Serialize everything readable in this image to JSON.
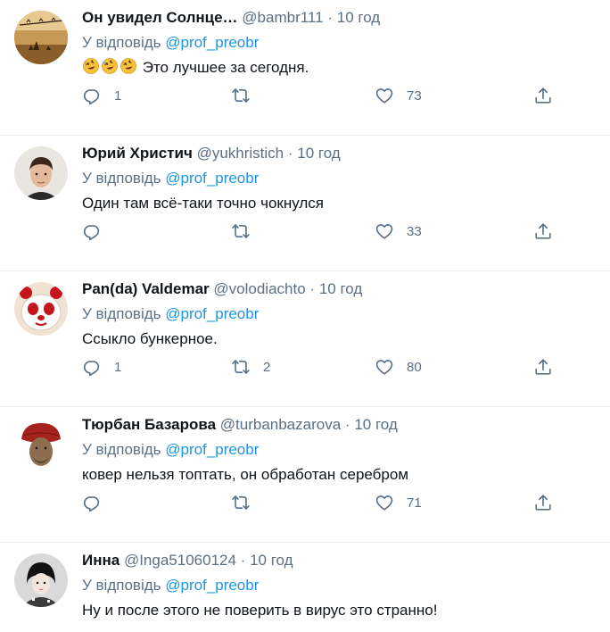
{
  "reply_prefix": "У відповідь",
  "tweets": [
    {
      "name": "Он увидел Солнце…",
      "handle": "@bambr111",
      "time": "10 год",
      "reply_to": "@prof_preobr",
      "text": "Это лучшее за сегодня.",
      "emoji": [
        "rolling-on-floor-laughing",
        "rolling-on-floor-laughing",
        "rolling-on-floor-laughing"
      ],
      "replies": "1",
      "retweets": "",
      "likes": "73"
    },
    {
      "name": "Юрий Христич",
      "handle": "@yukhristich",
      "time": "10 год",
      "reply_to": "@prof_preobr",
      "text": "Один там всё-таки точно чокнулся",
      "replies": "",
      "retweets": "",
      "likes": "33"
    },
    {
      "name": "Pan(da) Valdemar",
      "handle": "@volodiachto",
      "time": "10 год",
      "reply_to": "@prof_preobr",
      "text": "Ссыкло бункерное.",
      "replies": "1",
      "retweets": "2",
      "likes": "80"
    },
    {
      "name": "Тюрбан Базарова",
      "handle": "@turbanbazarova",
      "time": "10 год",
      "reply_to": "@prof_preobr",
      "text": "ковер нельзя топтать, он обработан серебром",
      "replies": "",
      "retweets": "",
      "likes": "71"
    },
    {
      "name": "Инна",
      "handle": "@Inga51060124",
      "time": "10 год",
      "reply_to": "@prof_preobr",
      "text": "Ну и после этого не поверить в вирус это странно!"
    }
  ],
  "icons": {
    "reply": "reply-icon",
    "retweet": "retweet-icon",
    "like": "heart-icon",
    "share": "share-icon"
  },
  "colors": {
    "text": "#0f1419",
    "secondary": "#5b7083",
    "link": "#1b95e0",
    "divider": "#e6ecf0"
  }
}
